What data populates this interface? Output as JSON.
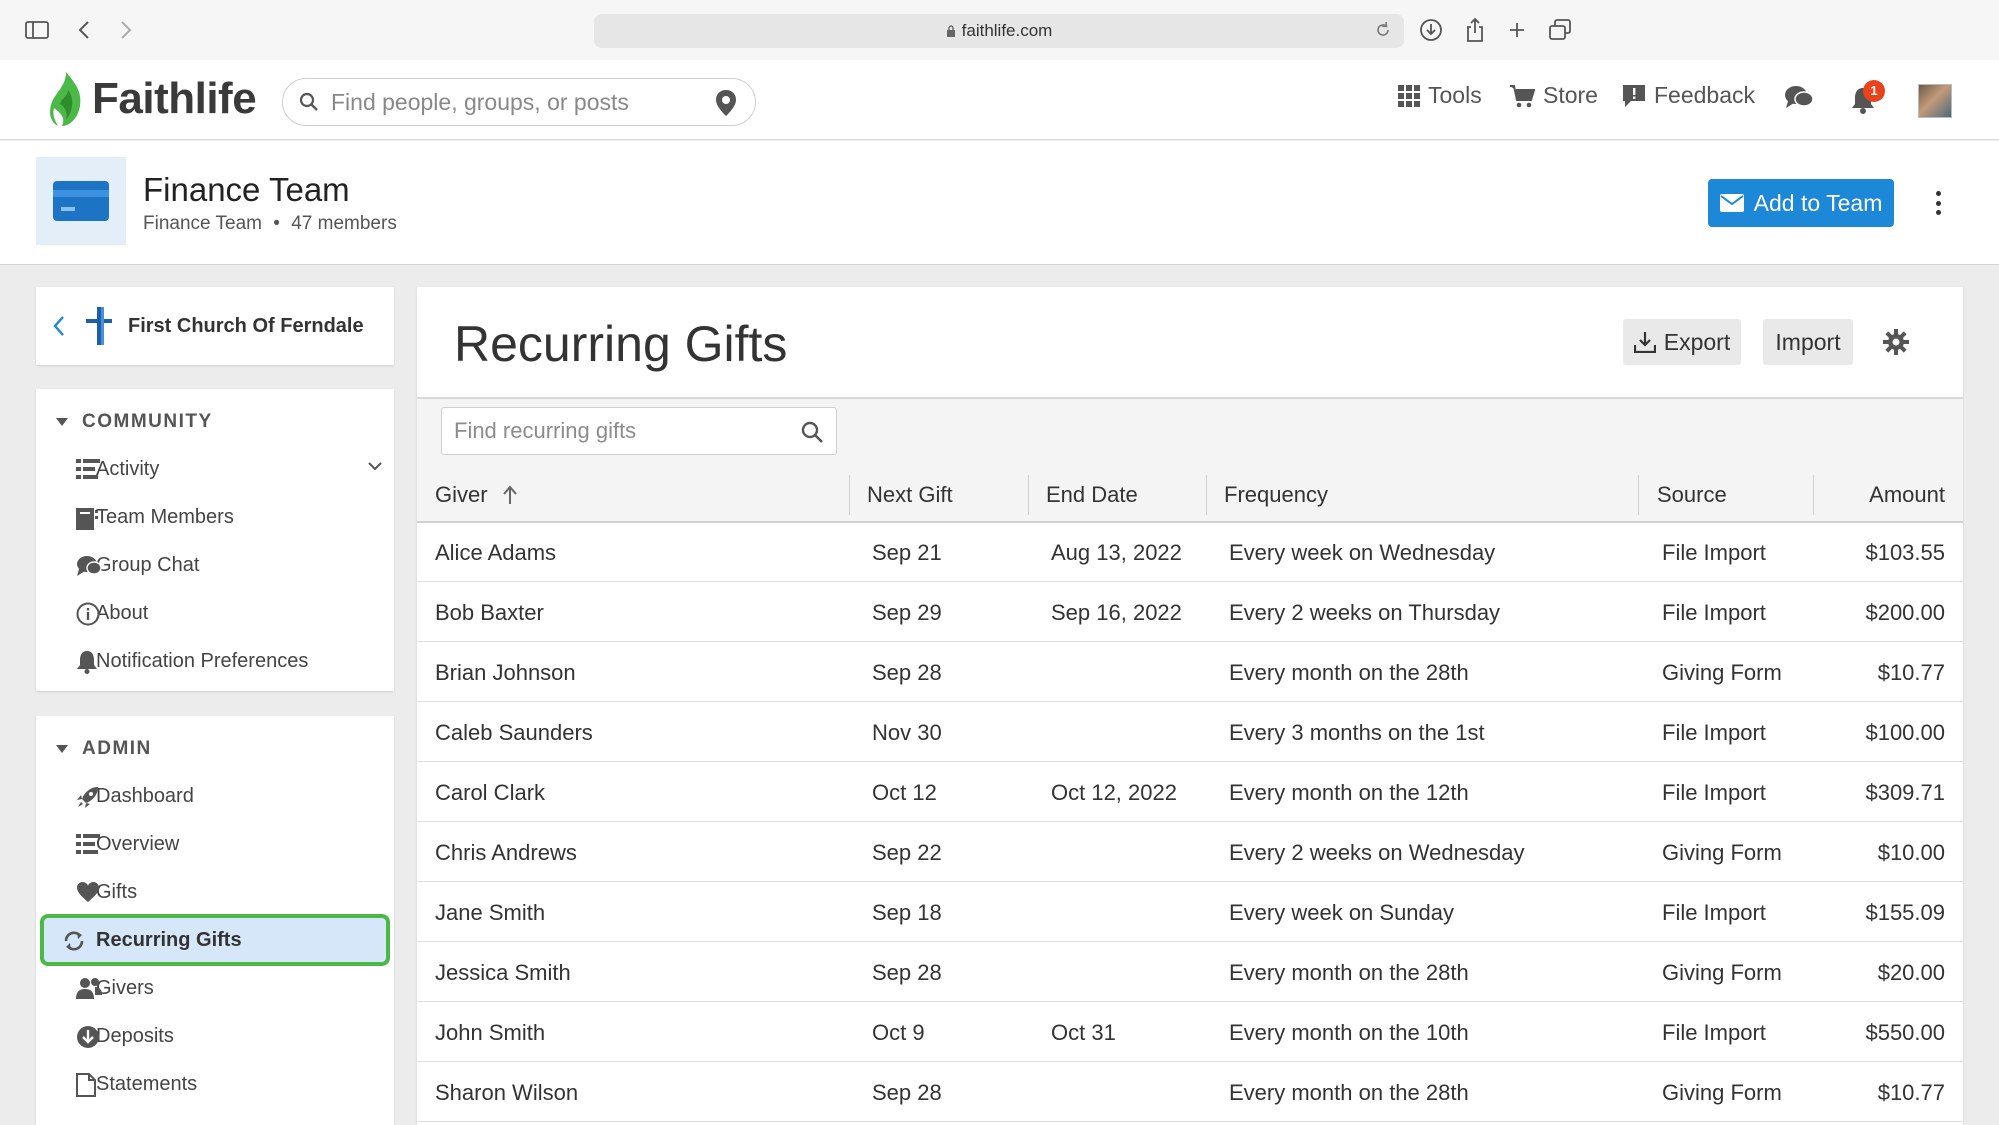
{
  "browser": {
    "url": "faithlife.com"
  },
  "header": {
    "logo_text": "Faithlife",
    "search_placeholder": "Find people, groups, or posts",
    "nav": {
      "tools": "Tools",
      "store": "Store",
      "feedback": "Feedback"
    },
    "notification_count": "1"
  },
  "group": {
    "title": "Finance Team",
    "subtitle_type": "Finance Team",
    "subtitle_sep": "•",
    "subtitle_members": "47 members",
    "add_button": "Add to Team"
  },
  "sidebar": {
    "church_name": "First Church Of Ferndale",
    "community_heading": "COMMUNITY",
    "community_items": [
      {
        "label": "Activity",
        "icon": "activity-list-icon"
      },
      {
        "label": "Team Members",
        "icon": "members-icon"
      },
      {
        "label": "Group Chat",
        "icon": "chat-icon"
      },
      {
        "label": "About",
        "icon": "info-icon"
      },
      {
        "label": "Notification Preferences",
        "icon": "bell-icon"
      }
    ],
    "admin_heading": "ADMIN",
    "admin_items": [
      {
        "label": "Dashboard",
        "icon": "rocket-icon"
      },
      {
        "label": "Overview",
        "icon": "overview-list-icon"
      },
      {
        "label": "Gifts",
        "icon": "heart-icon"
      },
      {
        "label": "Recurring Gifts",
        "icon": "recurring-icon"
      },
      {
        "label": "Givers",
        "icon": "givers-icon"
      },
      {
        "label": "Deposits",
        "icon": "deposit-icon"
      },
      {
        "label": "Statements",
        "icon": "document-icon"
      }
    ]
  },
  "main": {
    "title": "Recurring Gifts",
    "export_label": "Export",
    "import_label": "Import",
    "search_placeholder": "Find recurring gifts",
    "columns": [
      "Giver",
      "Next Gift",
      "End Date",
      "Frequency",
      "Source",
      "Amount"
    ],
    "rows": [
      {
        "giver": "Alice Adams",
        "next": "Sep 21",
        "end": "Aug 13, 2022",
        "freq": "Every week on Wednesday",
        "source": "File Import",
        "amount": "$103.55"
      },
      {
        "giver": "Bob Baxter",
        "next": "Sep 29",
        "end": "Sep 16, 2022",
        "freq": "Every 2 weeks on Thursday",
        "source": "File Import",
        "amount": "$200.00"
      },
      {
        "giver": "Brian Johnson",
        "next": "Sep 28",
        "end": "",
        "freq": "Every month on the 28th",
        "source": "Giving Form",
        "amount": "$10.77"
      },
      {
        "giver": "Caleb Saunders",
        "next": "Nov 30",
        "end": "",
        "freq": "Every 3 months on the 1st",
        "source": "File Import",
        "amount": "$100.00"
      },
      {
        "giver": "Carol Clark",
        "next": "Oct 12",
        "end": "Oct 12, 2022",
        "freq": "Every month on the 12th",
        "source": "File Import",
        "amount": "$309.71"
      },
      {
        "giver": "Chris Andrews",
        "next": "Sep 22",
        "end": "",
        "freq": "Every 2 weeks on Wednesday",
        "source": "Giving Form",
        "amount": "$10.00"
      },
      {
        "giver": "Jane Smith",
        "next": "Sep 18",
        "end": "",
        "freq": "Every week on Sunday",
        "source": "File Import",
        "amount": "$155.09"
      },
      {
        "giver": "Jessica Smith",
        "next": "Sep 28",
        "end": "",
        "freq": "Every month on the 28th",
        "source": "Giving Form",
        "amount": "$20.00"
      },
      {
        "giver": "John Smith",
        "next": "Oct 9",
        "end": "Oct 31",
        "freq": "Every month on the 10th",
        "source": "File Import",
        "amount": "$550.00"
      },
      {
        "giver": "Sharon Wilson",
        "next": "Sep 28",
        "end": "",
        "freq": "Every month on the 28th",
        "source": "Giving Form",
        "amount": "$10.77"
      }
    ]
  },
  "colors": {
    "accent": "#1d87d8",
    "highlight_border": "#4cb848",
    "active_bg": "#d5e7f8",
    "logo_green": "#4cb848"
  }
}
